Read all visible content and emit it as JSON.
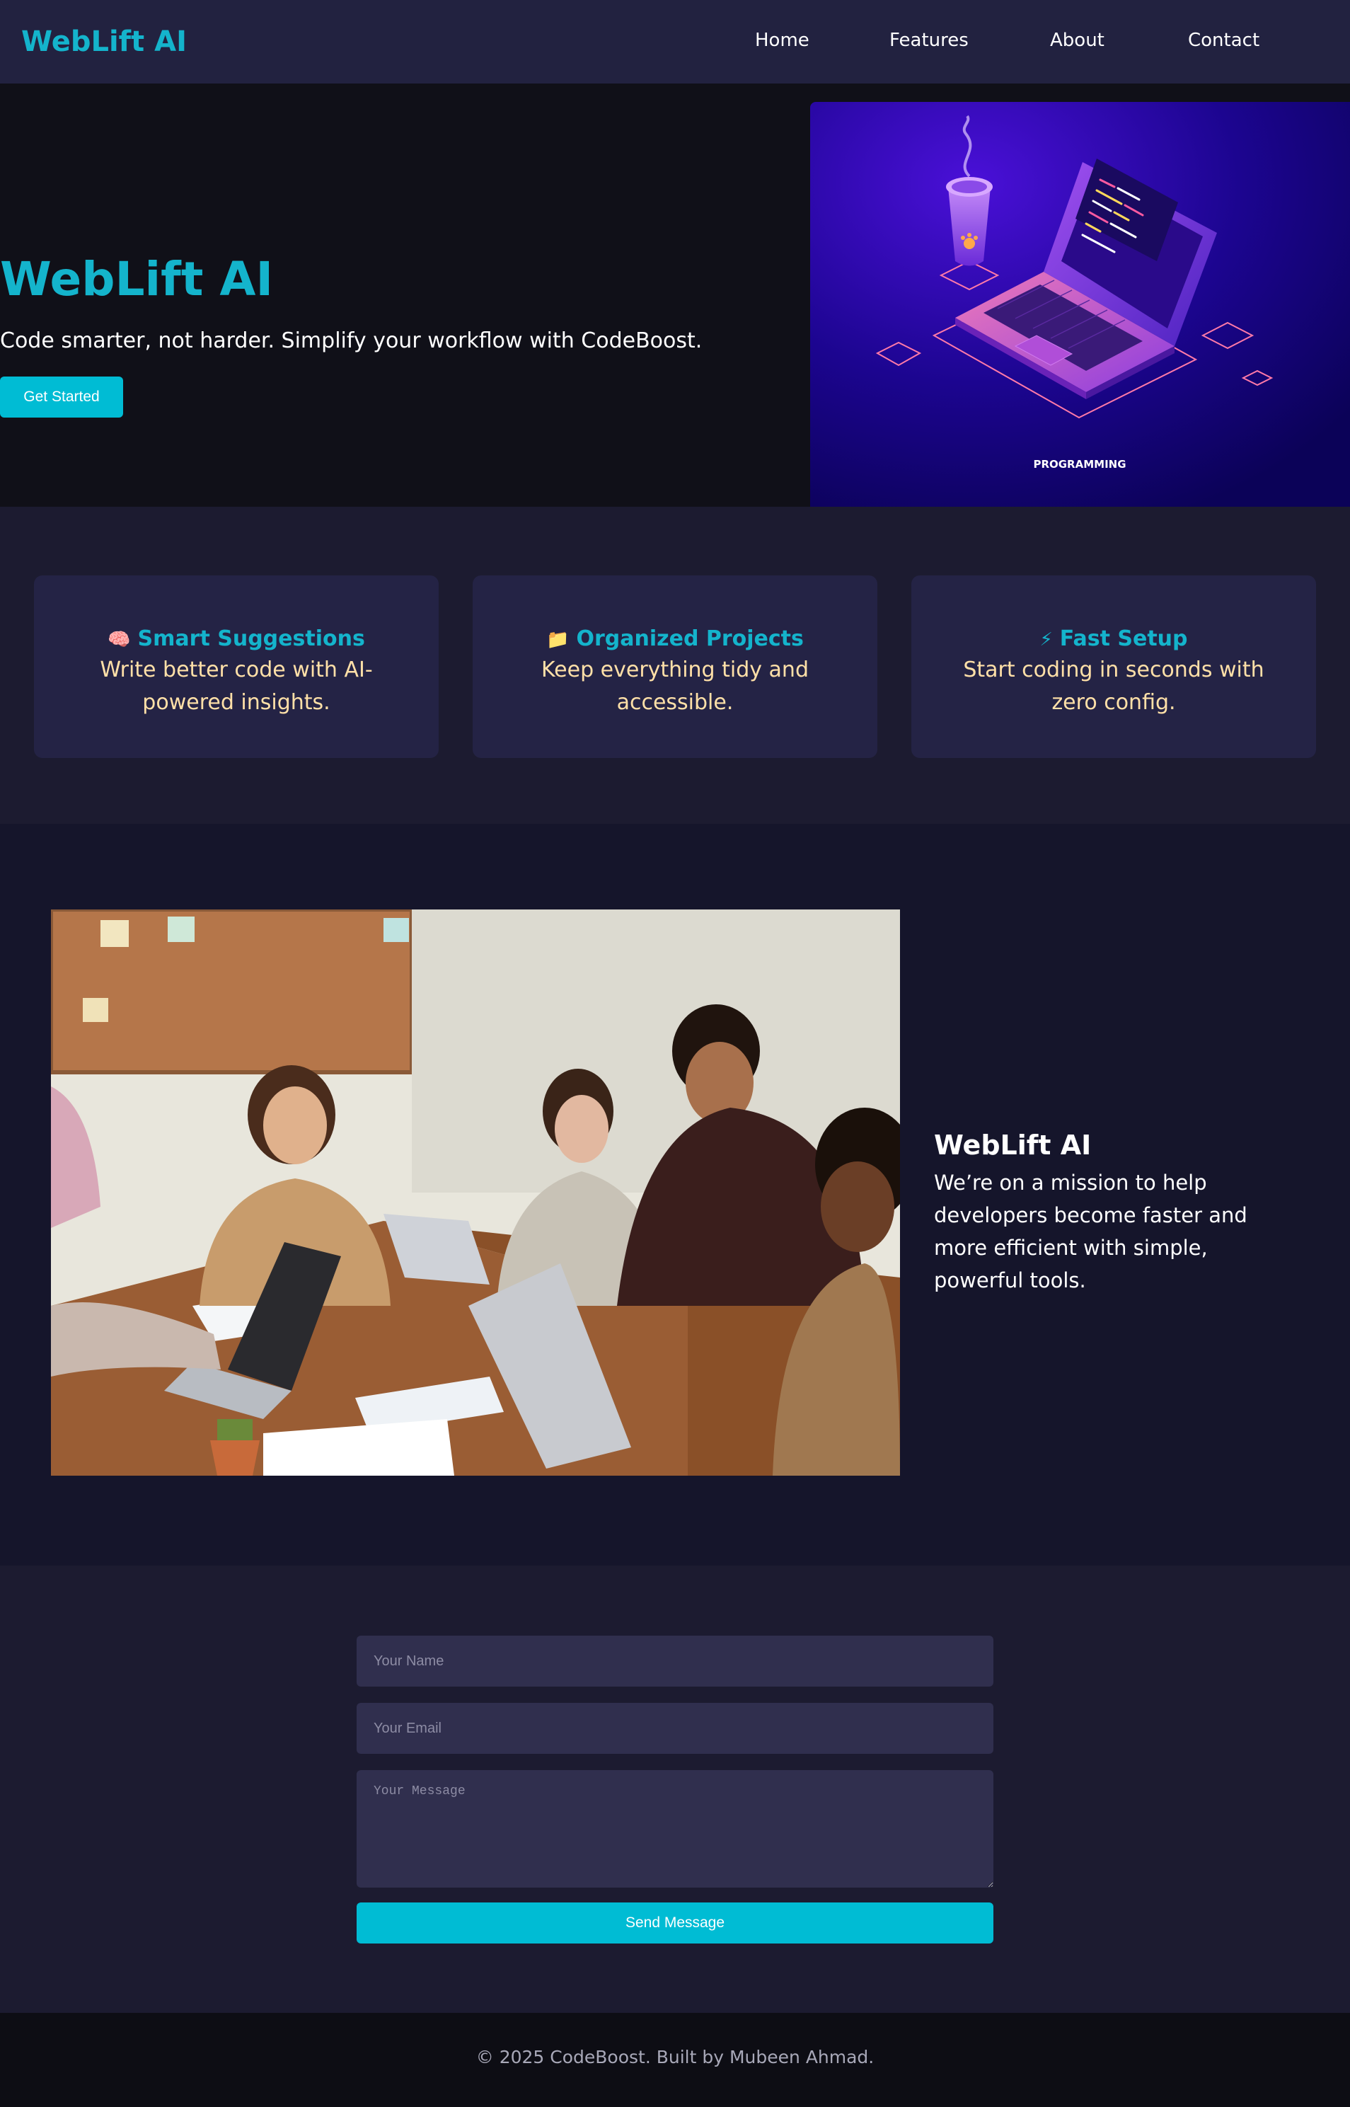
{
  "navbar": {
    "logo": "WebLift AI",
    "links": [
      "Home",
      "Features",
      "About",
      "Contact"
    ]
  },
  "hero": {
    "title": "WebLift AI",
    "subtitle": "Code smarter, not harder. Simplify your workflow with CodeBoost.",
    "button_label": "Get Started",
    "image_caption": "PROGRAMMING"
  },
  "features": [
    {
      "icon": "🧠",
      "icon_name": "brain-icon",
      "title": "Smart Suggestions",
      "description": "Write better code with AI-powered insights."
    },
    {
      "icon": "📁",
      "icon_name": "folder-icon",
      "title": "Organized Projects",
      "description": "Keep everything tidy and accessible."
    },
    {
      "icon": "⚡",
      "icon_name": "lightning-icon",
      "title": "Fast Setup",
      "description": "Start coding in seconds with zero config."
    }
  ],
  "about": {
    "title": "WebLift AI",
    "text": "We’re on a mission to help developers become faster and more efficient with simple, powerful tools."
  },
  "contact": {
    "name_placeholder": "Your Name",
    "email_placeholder": "Your Email",
    "message_placeholder": "Your Message",
    "send_label": "Send Message"
  },
  "footer": {
    "text": "© 2025 CodeBoost. Built by Mubeen Ahmad."
  },
  "colors": {
    "accent": "#00bcd4",
    "logo": "#14b4cc",
    "feature_text": "#ffe0a8",
    "navbar_bg": "#222240"
  }
}
